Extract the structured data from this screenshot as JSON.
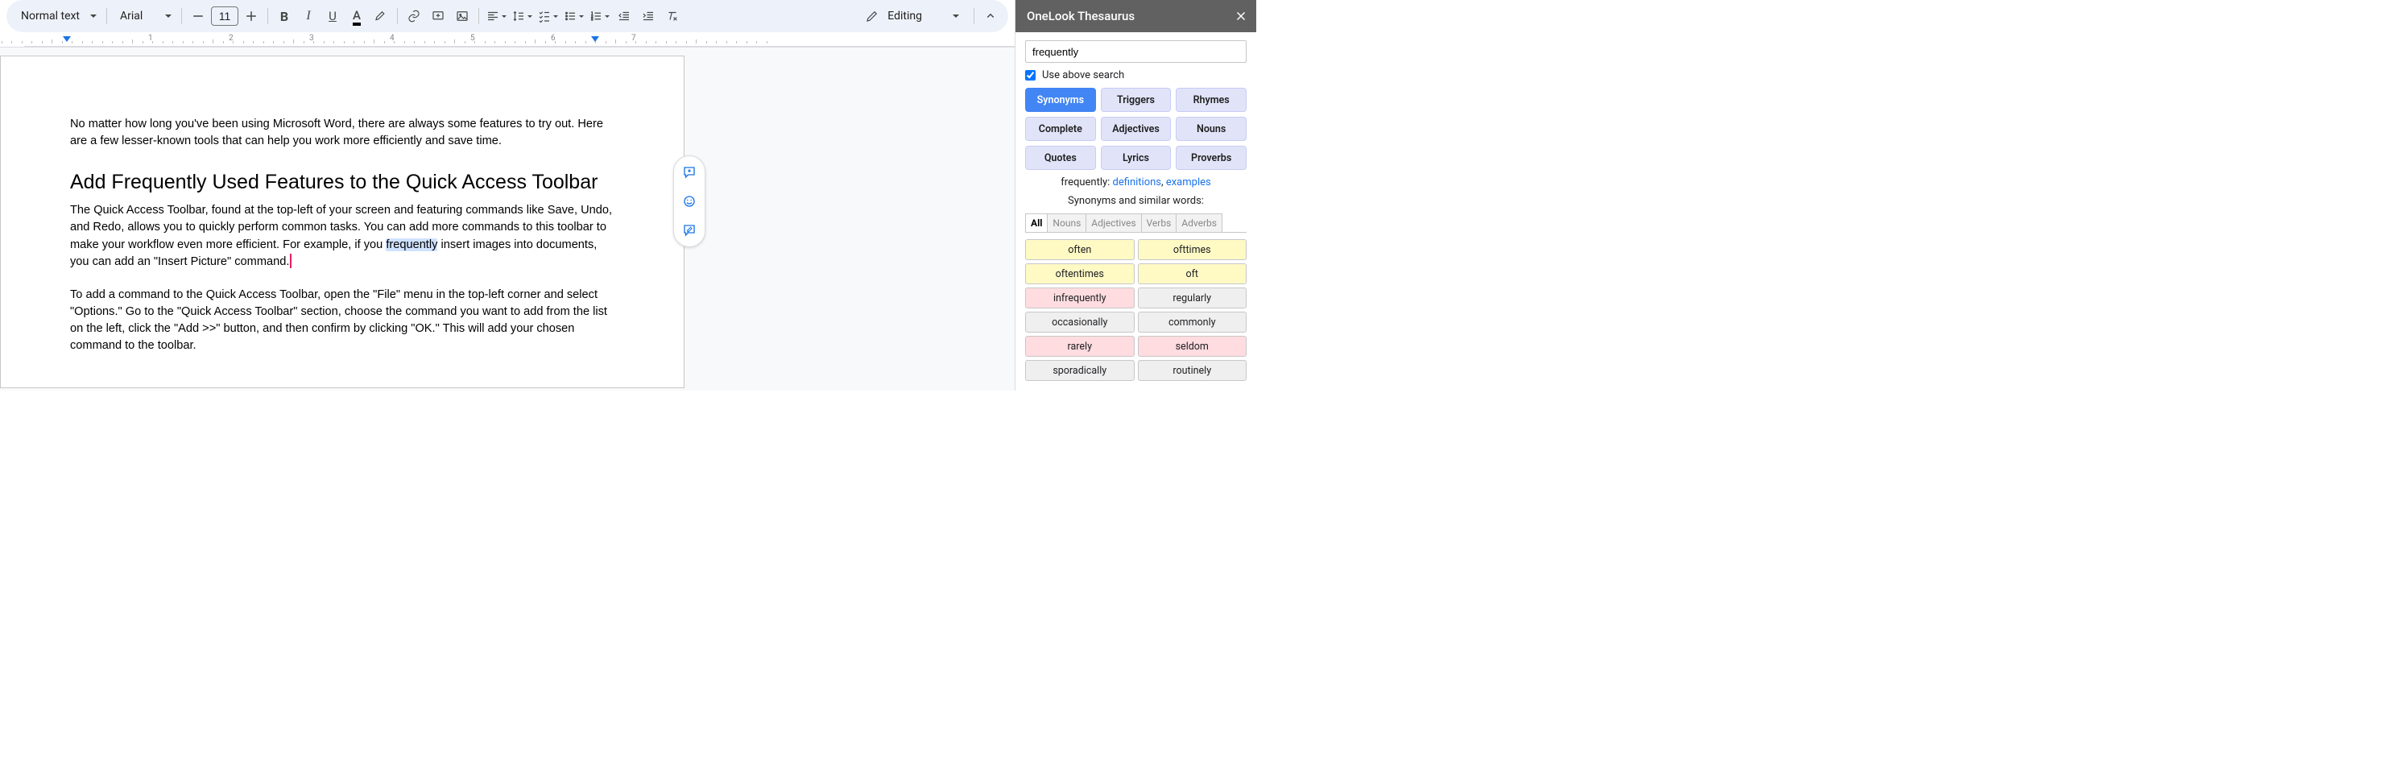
{
  "toolbar": {
    "style": "Normal text",
    "font": "Arial",
    "fontSize": "11",
    "editing": "Editing"
  },
  "ruler": {
    "numbers": [
      "1",
      "2",
      "3",
      "4",
      "5",
      "6",
      "7"
    ]
  },
  "doc": {
    "p1a": "No matter how long you've been using Microsoft Word, there are always some features to try out. Here are a few ",
    "p1b": "lesser-known",
    "p1c": " tools that can help you work more efficiently and save time.",
    "h2": "Add Frequently Used Features to the Quick Access Toolbar",
    "p2a": "The Quick Access Toolbar, found at the top-left of your screen and featuring commands like Save, Undo, and Redo, allows you to quickly perform common tasks. You can add more commands to this toolbar to make your workflow even more efficient. For example, if you ",
    "p2_highlight": "frequently",
    "p2b": " insert images into documents, you can add an \"Insert Picture\" command.",
    "p3": "To add a command to the Quick Access Toolbar, open the \"File\" menu in the top-left corner and select \"Options.\" Go to the \"Quick Access Toolbar\" section, choose the command you want to add from the list on the left, click the \"Add >>\" button, and then confirm by clicking \"OK.\" This will add your chosen command to the toolbar."
  },
  "sidebar": {
    "title": "OneLook Thesaurus",
    "search": "frequently",
    "useAbove": "Use above search",
    "tabs": [
      "Synonyms",
      "Triggers",
      "Rhymes",
      "Complete",
      "Adjectives",
      "Nouns",
      "Quotes",
      "Lyrics",
      "Proverbs"
    ],
    "activeTab": 0,
    "wordLine": {
      "prefix": "frequently: ",
      "l1": "definitions",
      "sep": ", ",
      "l2": "examples"
    },
    "sectionTitle": "Synonyms and similar words:",
    "posTabs": [
      "All",
      "Nouns",
      "Adjectives",
      "Verbs",
      "Adverbs"
    ],
    "results": [
      {
        "w": "often",
        "c": "y"
      },
      {
        "w": "ofttimes",
        "c": "y"
      },
      {
        "w": "oftentimes",
        "c": "y"
      },
      {
        "w": "oft",
        "c": "y"
      },
      {
        "w": "infrequently",
        "c": "r"
      },
      {
        "w": "regularly",
        "c": "g"
      },
      {
        "w": "occasionally",
        "c": "g"
      },
      {
        "w": "commonly",
        "c": "g"
      },
      {
        "w": "rarely",
        "c": "r"
      },
      {
        "w": "seldom",
        "c": "r"
      },
      {
        "w": "sporadically",
        "c": "g"
      },
      {
        "w": "routinely",
        "c": "g"
      }
    ]
  }
}
